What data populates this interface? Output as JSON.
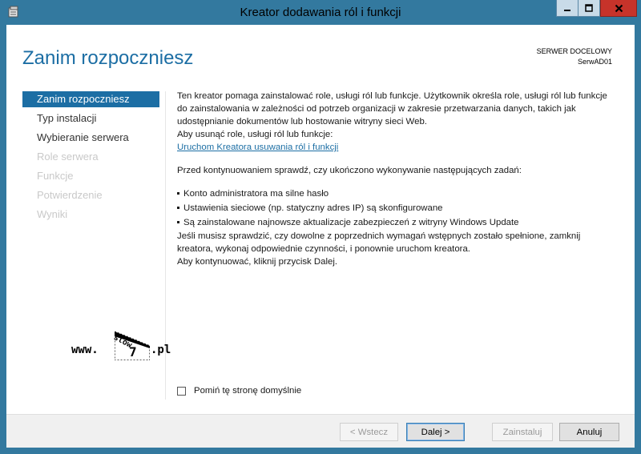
{
  "window": {
    "title": "Kreator dodawania ról i funkcji",
    "controls": {
      "minimize": "minimize",
      "maximize": "maximize",
      "close": "close"
    }
  },
  "header": {
    "page_title": "Zanim rozpoczniesz",
    "server_caption": "SERWER DOCELOWY",
    "server_name": "SerwAD01"
  },
  "nav": {
    "items": [
      {
        "label": "Zanim rozpoczniesz",
        "state": "active"
      },
      {
        "label": "Typ instalacji",
        "state": "enabled"
      },
      {
        "label": "Wybieranie serwera",
        "state": "enabled"
      },
      {
        "label": "Role serwera",
        "state": "inactive"
      },
      {
        "label": "Funkcje",
        "state": "inactive"
      },
      {
        "label": "Potwierdzenie",
        "state": "inactive"
      },
      {
        "label": "Wyniki",
        "state": "inactive"
      }
    ]
  },
  "main": {
    "intro": "Ten kreator pomaga zainstalować role, usługi ról lub funkcje. Użytkownik określa role, usługi ról lub funkcje do zainstalowania w zależności od potrzeb organizacji w zakresie przetwarzania danych, takich jak udostępnianie dokumentów lub hostowanie witryny sieci Web.",
    "remove_text": "Aby usunąć role, usługi ról lub funkcje:",
    "remove_link": "Uruchom Kreatora usuwania ról i funkcji",
    "before_text": "Przed kontynuowaniem sprawdź, czy ukończono wykonywanie następujących zadań:",
    "bullets": [
      "Konto administratora ma silne hasło",
      "Ustawienia sieciowe (np. statyczny adres IP) są skonfigurowane",
      "Są zainstalowane najnowsze aktualizacje zabezpieczeń z witryny Windows Update"
    ],
    "check_text": "Jeśli musisz sprawdzić, czy dowolne z poprzednich wymagań wstępnych zostało spełnione, zamknij kreatora, wykonaj odpowiednie czynności, i ponownie uruchom kreatora.",
    "continue_text": "Aby kontynuować, kliknij przycisk Dalej."
  },
  "checkbox": {
    "label": "Pomiń tę stronę domyślnie",
    "checked": false
  },
  "watermark": {
    "www": "www.",
    "slow": "slow",
    "seven": "7",
    "pl": ".pl"
  },
  "buttons": {
    "back": "< Wstecz",
    "next": "Dalej >",
    "install": "Zainstaluj",
    "cancel": "Anuluj"
  },
  "colors": {
    "accent": "#1c6ea4",
    "titlebar": "#33799f",
    "close": "#c7332a"
  }
}
